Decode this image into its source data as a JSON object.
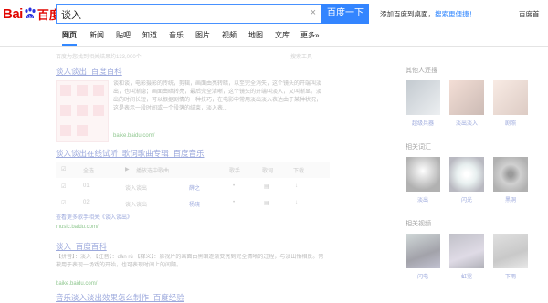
{
  "header": {
    "logo": {
      "left": "Bai",
      "right": "百度"
    },
    "query": "谈入",
    "clear_glyph": "×",
    "search_button": "百度一下",
    "promo_text": "添加百度到桌面，",
    "promo_emph": "搜索更便捷！",
    "setting": "百度首"
  },
  "tabs": [
    "网页",
    "新闻",
    "贴吧",
    "知道",
    "音乐",
    "图片",
    "视频",
    "地图",
    "文库",
    "更多»"
  ],
  "active_tab": 0,
  "results": {
    "meta": "百度为您找到相关结果约133,000个",
    "tool": "搜索工具",
    "r1": {
      "title": "谈入谈出_百度百科",
      "text": "谈和谈，电影摄影的传统，剪辑，画面由亮转暗，以至完全消失，这个镜头的开端叫淡出，也叫渐隐；画面由暗转亮，最后完全清晰，这个镜头的开端叫淡入，又叫渐显。淡出的时间长短，可以根据剧情的一种技巧，在电影中常用淡出淡入表达由于某种状况，这是表示一段时间或一个段落的结束，淡入表...",
      "url": "baike.baidu.com/"
    },
    "r2": {
      "title": "谈入谈出在线试听_歌词歌曲专辑_百度音乐",
      "headers": [
        "全选",
        "播放选中歌曲",
        "歌手",
        "歌词",
        "下载"
      ],
      "rows": [
        {
          "idx": "01",
          "name": "谈入谈出",
          "singer": "薛之"
        },
        {
          "idx": "02",
          "name": "谈入谈出",
          "singer": "杨晓"
        }
      ],
      "more": "查看更多歌手相关《谈入谈出》",
      "url": "music.baidu.com/"
    },
    "r3": {
      "title": "谈入_百度百科",
      "text": "【拼音】：淡入 【注音】：dàn rù 【释义】：影视片的画面由黑暗逐渐变亮到完全清晰的过程，与淡出恰相反。常被用于表现一场戏的开始，也可表现时间上的间隔。",
      "url": "baike.baidu.com/"
    },
    "r4": {
      "title": "音乐淡入淡出效果怎么制作_百度经验"
    }
  },
  "right": {
    "sec1": {
      "title": "其他人还搜",
      "items": [
        "超级兵器",
        "淡出淡入",
        "剧照"
      ]
    },
    "sec2": {
      "title": "相关词汇",
      "items": [
        "淡出",
        "闪光",
        "黑洞"
      ]
    },
    "sec3": {
      "title": "相关视频",
      "items": [
        "闪电",
        "虹霓",
        "下雨"
      ]
    }
  }
}
